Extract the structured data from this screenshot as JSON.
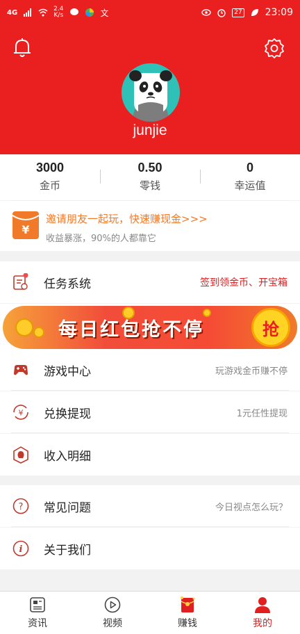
{
  "status_bar": {
    "signal": "4G",
    "net_speed_value": "2.4",
    "net_speed_unit": "K/s",
    "battery": "27",
    "time": "23:09"
  },
  "profile": {
    "username": "junjie"
  },
  "stats": [
    {
      "value": "3000",
      "label": "金币"
    },
    {
      "value": "0.50",
      "label": "零钱"
    },
    {
      "value": "0",
      "label": "幸运值"
    }
  ],
  "invite": {
    "title": "邀请朋友一起玩，快速赚现金>>>",
    "subtitle": "收益暴涨，90%的人都靠它"
  },
  "task_row": {
    "label": "任务系统",
    "right": "签到领金币、开宝箱"
  },
  "banner": {
    "text": "每日红包抢不停",
    "button": "抢"
  },
  "menu": [
    {
      "label": "游戏中心",
      "right": "玩游戏金币赚不停"
    },
    {
      "label": "兑换提现",
      "right": "1元任性提现"
    },
    {
      "label": "收入明细",
      "right": ""
    }
  ],
  "menu2": [
    {
      "label": "常见问题",
      "right": "今日视点怎么玩？"
    },
    {
      "label": "关于我们",
      "right": ""
    }
  ],
  "tabs": [
    {
      "label": "资讯",
      "icon": "news-icon"
    },
    {
      "label": "视频",
      "icon": "video-icon"
    },
    {
      "label": "赚钱",
      "icon": "redpacket-icon"
    },
    {
      "label": "我的",
      "icon": "user-icon"
    }
  ],
  "colors": {
    "brand_red": "#ea2020",
    "accent_orange": "#f07a2a"
  }
}
